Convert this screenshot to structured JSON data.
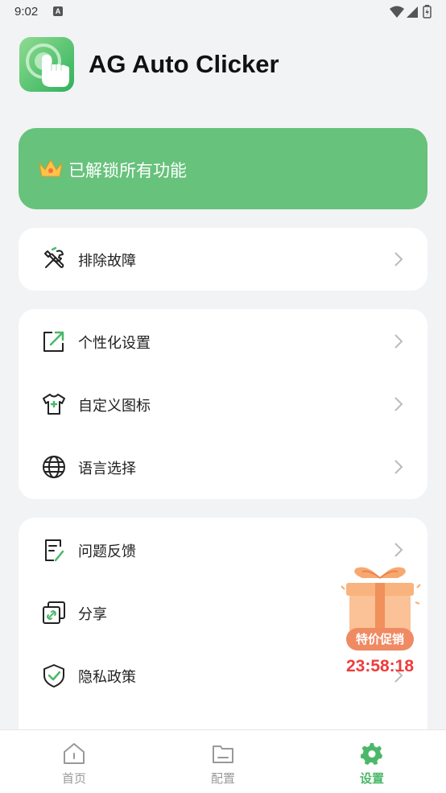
{
  "status_bar": {
    "time": "9:02",
    "notification_badge": "A",
    "icons": [
      "wifi-icon",
      "signal-icon",
      "battery-icon"
    ]
  },
  "app": {
    "title": "AG Auto Clicker",
    "logo": "hand-tap-logo"
  },
  "premium": {
    "label": "已解锁所有功能",
    "icon": "crown-icon",
    "color": "#67c27c"
  },
  "sections": [
    {
      "items": [
        {
          "label": "排除故障",
          "icon": "wrench-screwdriver-icon"
        }
      ]
    },
    {
      "items": [
        {
          "label": "个性化设置",
          "icon": "personalize-icon"
        },
        {
          "label": "自定义图标",
          "icon": "tshirt-icon"
        },
        {
          "label": "语言选择",
          "icon": "globe-icon"
        }
      ]
    },
    {
      "items": [
        {
          "label": "问题反馈",
          "icon": "feedback-icon"
        },
        {
          "label": "分享",
          "icon": "share-link-icon"
        },
        {
          "label": "隐私政策",
          "icon": "shield-check-icon"
        }
      ]
    }
  ],
  "promo": {
    "badge": "特价促销",
    "countdown": "23:58:18",
    "icon": "gift-box-icon"
  },
  "bottom_nav": [
    {
      "label": "首页",
      "icon": "home-icon",
      "active": false
    },
    {
      "label": "配置",
      "icon": "folder-icon",
      "active": false
    },
    {
      "label": "设置",
      "icon": "gear-icon",
      "active": true
    }
  ],
  "colors": {
    "accent": "#4bb869",
    "premium": "#67c27c",
    "background": "#f2f3f5",
    "timer": "#ef3b3b"
  }
}
